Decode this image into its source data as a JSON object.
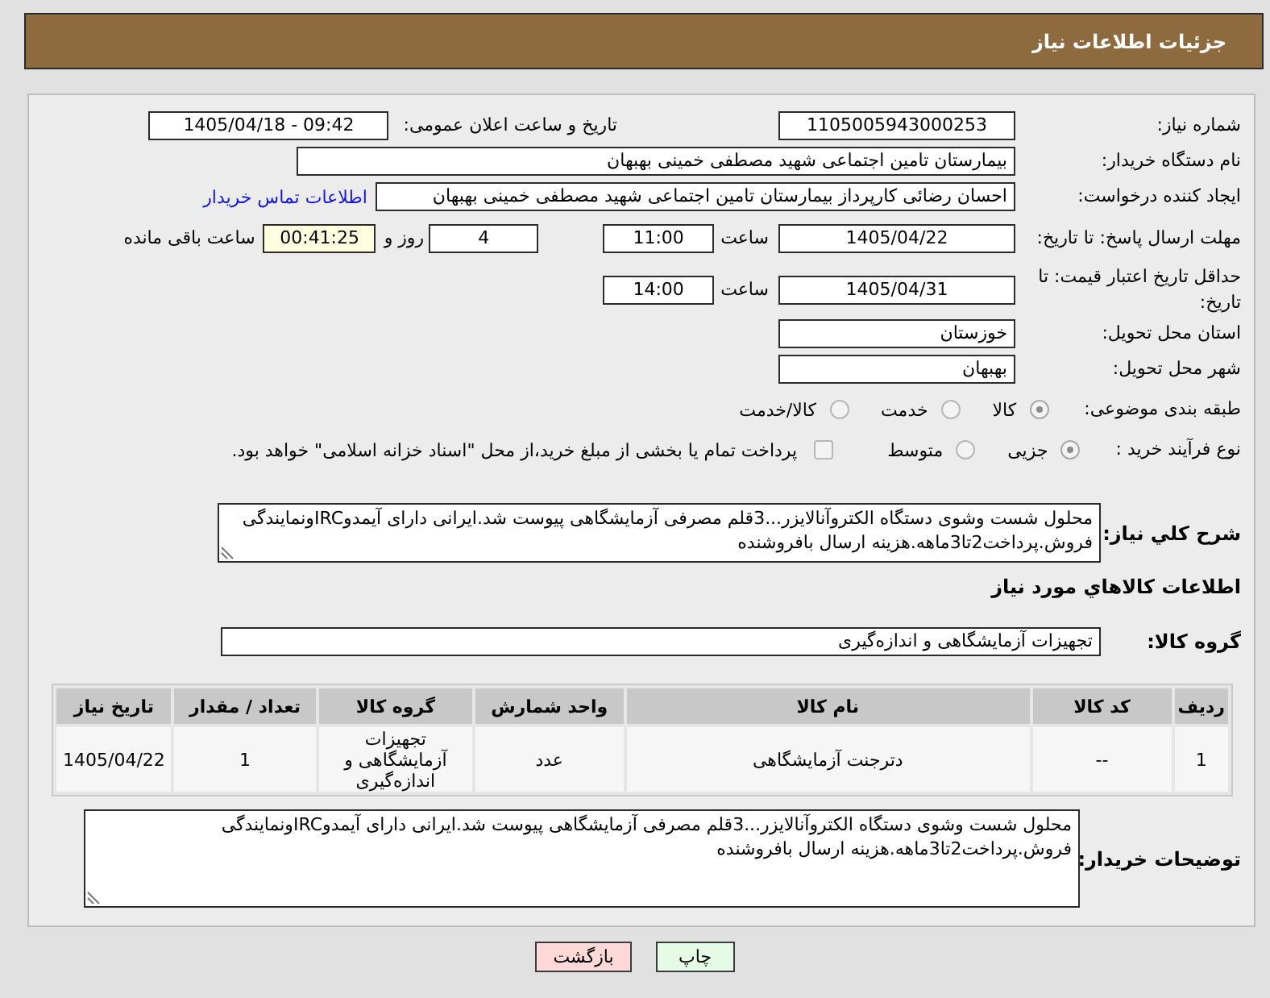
{
  "header": {
    "title": "جزئیات اطلاعات نیاز"
  },
  "need_number": {
    "label": "شماره نیاز:",
    "value": "1105005943000253"
  },
  "announce_datetime": {
    "label": "تاریخ و ساعت اعلان عمومی:",
    "value": "1405/04/18 - 09:42"
  },
  "buyer_org": {
    "label": "نام دستگاه خریدار:",
    "value": "بیمارستان تامین اجتماعی شهید مصطفی خمینی بهبهان"
  },
  "requester": {
    "label": "ایجاد کننده درخواست:",
    "value": "احسان رضائی کارپرداز بیمارستان تامین اجتماعی شهید مصطفی خمینی بهبهان",
    "link": "اطلاعات تماس خریدار"
  },
  "response_deadline": {
    "label": "مهلت ارسال پاسخ: تا تاریخ:",
    "date": "1405/04/22",
    "time_label": "ساعت",
    "time": "11:00",
    "days": "4",
    "days_label": "روز و",
    "remaining": "00:41:25",
    "remaining_label": "ساعت باقی مانده"
  },
  "price_validity": {
    "label": "حداقل تاریخ اعتبار قیمت: تا تاریخ:",
    "date": "1405/04/31",
    "time_label": "ساعت",
    "time": "14:00"
  },
  "delivery_province": {
    "label": "استان محل تحویل:",
    "value": "خوزستان"
  },
  "delivery_city": {
    "label": "شهر محل تحویل:",
    "value": "بهبهان"
  },
  "subject_category": {
    "label": "طبقه بندی موضوعی:",
    "options": [
      {
        "label": "کالا",
        "selected": true
      },
      {
        "label": "خدمت",
        "selected": false
      },
      {
        "label": "کالا/خدمت",
        "selected": false
      }
    ]
  },
  "purchase_process": {
    "label": "نوع فرآیند خرید :",
    "options": [
      {
        "label": "جزیی",
        "selected": true
      },
      {
        "label": "متوسط",
        "selected": false
      }
    ],
    "treasury_payment": {
      "label": "پرداخت تمام یا بخشی از مبلغ خرید،از محل \"اسناد خزانه اسلامی\" خواهد بود.",
      "checked": false
    }
  },
  "general_description": {
    "label": "شرح کلي نیاز:",
    "value": "محلول شست وشوی دستگاه الکتروآنالایزر...3قلم مصرفی آزمایشگاهی پیوست شد.ایرانی دارای آیمدوIRCونمایندگی فروش.پرداخت2تا3ماهه.هزینه ارسال بافروشنده"
  },
  "items_section": {
    "title": "اطلاعات كالاهاي مورد نياز",
    "goods_group": {
      "label": "گروه کالا:",
      "value": "تجهیزات آزمایشگاهی و اندازه‌گیری"
    }
  },
  "table": {
    "columns": [
      "ردیف",
      "کد کالا",
      "نام کالا",
      "واحد شمارش",
      "گروه کالا",
      "تعداد / مقدار",
      "تاریخ نیاز"
    ],
    "rows": [
      [
        "1",
        "--",
        "دترجنت آزمایشگاهی",
        "عدد",
        "تجهیزات آزمایشگاهی و اندازه‌گیری",
        "1",
        "1405/04/22"
      ]
    ]
  },
  "buyer_notes": {
    "label": "توضیحات خریدار:",
    "value": "محلول شست وشوی دستگاه الکتروآنالایزر...3قلم مصرفی آزمایشگاهی پیوست شد.ایرانی دارای آیمدوIRCونمایندگی فروش.پرداخت2تا3ماهه.هزینه ارسال بافروشنده"
  },
  "buttons": [
    {
      "label": "چاپ",
      "kind": "print"
    },
    {
      "label": "بازگشت",
      "kind": "back"
    }
  ]
}
